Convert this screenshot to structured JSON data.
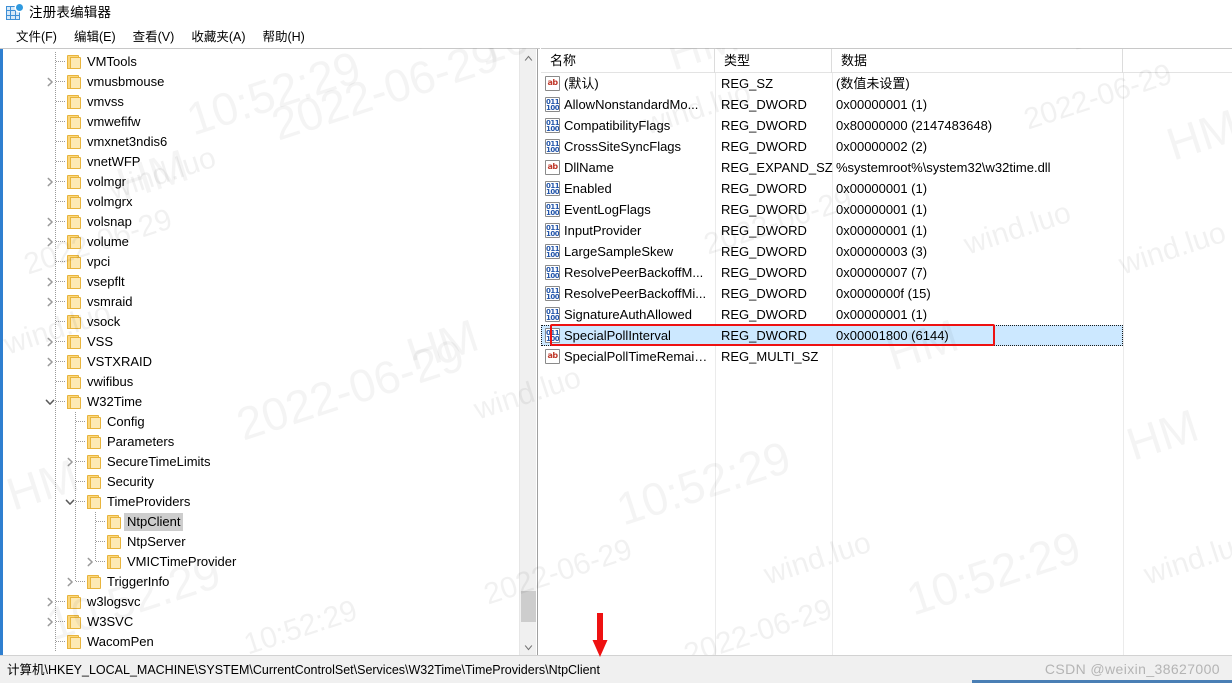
{
  "window": {
    "title": "注册表编辑器",
    "icon": "registry-editor-icon"
  },
  "menu": {
    "items": [
      {
        "label": "文件(F)",
        "name": "menu-file"
      },
      {
        "label": "编辑(E)",
        "name": "menu-edit"
      },
      {
        "label": "查看(V)",
        "name": "menu-view"
      },
      {
        "label": "收藏夹(A)",
        "name": "menu-favorites"
      },
      {
        "label": "帮助(H)",
        "name": "menu-help"
      }
    ]
  },
  "tree": {
    "selected_key": "NtpClient",
    "items": [
      {
        "label": "VMTools",
        "depth": 3,
        "expander": "none",
        "last": false
      },
      {
        "label": "vmusbmouse",
        "depth": 3,
        "expander": "collapsed",
        "last": false
      },
      {
        "label": "vmvss",
        "depth": 3,
        "expander": "none",
        "last": false
      },
      {
        "label": "vmwefifw",
        "depth": 3,
        "expander": "none",
        "last": false
      },
      {
        "label": "vmxnet3ndis6",
        "depth": 3,
        "expander": "none",
        "last": false
      },
      {
        "label": "vnetWFP",
        "depth": 3,
        "expander": "none",
        "last": false
      },
      {
        "label": "volmgr",
        "depth": 3,
        "expander": "collapsed",
        "last": false
      },
      {
        "label": "volmgrx",
        "depth": 3,
        "expander": "none",
        "last": false
      },
      {
        "label": "volsnap",
        "depth": 3,
        "expander": "collapsed",
        "last": false
      },
      {
        "label": "volume",
        "depth": 3,
        "expander": "collapsed",
        "last": false
      },
      {
        "label": "vpci",
        "depth": 3,
        "expander": "none",
        "last": false
      },
      {
        "label": "vsepflt",
        "depth": 3,
        "expander": "collapsed",
        "last": false
      },
      {
        "label": "vsmraid",
        "depth": 3,
        "expander": "collapsed",
        "last": false
      },
      {
        "label": "vsock",
        "depth": 3,
        "expander": "none",
        "last": false
      },
      {
        "label": "VSS",
        "depth": 3,
        "expander": "collapsed",
        "last": false
      },
      {
        "label": "VSTXRAID",
        "depth": 3,
        "expander": "collapsed",
        "last": false
      },
      {
        "label": "vwifibus",
        "depth": 3,
        "expander": "none",
        "last": false
      },
      {
        "label": "W32Time",
        "depth": 3,
        "expander": "expanded",
        "last": false
      },
      {
        "label": "Config",
        "depth": 4,
        "expander": "none",
        "last": false
      },
      {
        "label": "Parameters",
        "depth": 4,
        "expander": "none",
        "last": false
      },
      {
        "label": "SecureTimeLimits",
        "depth": 4,
        "expander": "collapsed",
        "last": false
      },
      {
        "label": "Security",
        "depth": 4,
        "expander": "none",
        "last": false
      },
      {
        "label": "TimeProviders",
        "depth": 4,
        "expander": "expanded",
        "last": false
      },
      {
        "label": "NtpClient",
        "depth": 5,
        "expander": "none",
        "last": false,
        "selected": true
      },
      {
        "label": "NtpServer",
        "depth": 5,
        "expander": "none",
        "last": false
      },
      {
        "label": "VMICTimeProvider",
        "depth": 5,
        "expander": "collapsed",
        "last": true
      },
      {
        "label": "TriggerInfo",
        "depth": 4,
        "expander": "collapsed",
        "last": true
      },
      {
        "label": "w3logsvc",
        "depth": 3,
        "expander": "collapsed",
        "last": false
      },
      {
        "label": "W3SVC",
        "depth": 3,
        "expander": "collapsed",
        "last": false
      },
      {
        "label": "WacomPen",
        "depth": 3,
        "expander": "none",
        "last": false
      }
    ]
  },
  "values": {
    "columns": [
      {
        "key": "name",
        "label": "名称"
      },
      {
        "key": "type",
        "label": "类型"
      },
      {
        "key": "data",
        "label": "数据"
      }
    ],
    "rows": [
      {
        "icon": "string-value-icon",
        "name": "(默认)",
        "type": "REG_SZ",
        "data": "(数值未设置)"
      },
      {
        "icon": "dword-value-icon",
        "name": "AllowNonstandardMo...",
        "type": "REG_DWORD",
        "data": "0x00000001 (1)"
      },
      {
        "icon": "dword-value-icon",
        "name": "CompatibilityFlags",
        "type": "REG_DWORD",
        "data": "0x80000000 (2147483648)"
      },
      {
        "icon": "dword-value-icon",
        "name": "CrossSiteSyncFlags",
        "type": "REG_DWORD",
        "data": "0x00000002 (2)"
      },
      {
        "icon": "string-value-icon",
        "name": "DllName",
        "type": "REG_EXPAND_SZ",
        "data": "%systemroot%\\system32\\w32time.dll"
      },
      {
        "icon": "dword-value-icon",
        "name": "Enabled",
        "type": "REG_DWORD",
        "data": "0x00000001 (1)"
      },
      {
        "icon": "dword-value-icon",
        "name": "EventLogFlags",
        "type": "REG_DWORD",
        "data": "0x00000001 (1)"
      },
      {
        "icon": "dword-value-icon",
        "name": "InputProvider",
        "type": "REG_DWORD",
        "data": "0x00000001 (1)"
      },
      {
        "icon": "dword-value-icon",
        "name": "LargeSampleSkew",
        "type": "REG_DWORD",
        "data": "0x00000003 (3)"
      },
      {
        "icon": "dword-value-icon",
        "name": "ResolvePeerBackoffM...",
        "type": "REG_DWORD",
        "data": "0x00000007 (7)"
      },
      {
        "icon": "dword-value-icon",
        "name": "ResolvePeerBackoffMi...",
        "type": "REG_DWORD",
        "data": "0x0000000f (15)"
      },
      {
        "icon": "dword-value-icon",
        "name": "SignatureAuthAllowed",
        "type": "REG_DWORD",
        "data": "0x00000001 (1)"
      },
      {
        "icon": "dword-value-icon",
        "name": "SpecialPollInterval",
        "type": "REG_DWORD",
        "data": "0x00001800 (6144)",
        "selected": true
      },
      {
        "icon": "string-value-icon",
        "name": "SpecialPollTimeRemain...",
        "type": "REG_MULTI_SZ",
        "data": ""
      }
    ]
  },
  "statusbar": {
    "path": "计算机\\HKEY_LOCAL_MACHINE\\SYSTEM\\CurrentControlSet\\Services\\W32Time\\TimeProviders\\NtpClient"
  },
  "watermark": {
    "csdn": "CSDN @weixin_38627000",
    "texts": [
      "HM",
      "wind.luo",
      "2022-06-29",
      "10:52:29"
    ]
  },
  "annotations": {
    "highlight_row": "SpecialPollInterval",
    "highlight_color": "#ee1111",
    "arrow_direction": "down"
  },
  "colors": {
    "selection_blue": "#cce8ff",
    "tree_selection_gray": "#cdcdcd",
    "folder_yellow": "#fbd67a",
    "accent_blue": "#2f7fd0",
    "annotation_red": "#ee1111"
  }
}
